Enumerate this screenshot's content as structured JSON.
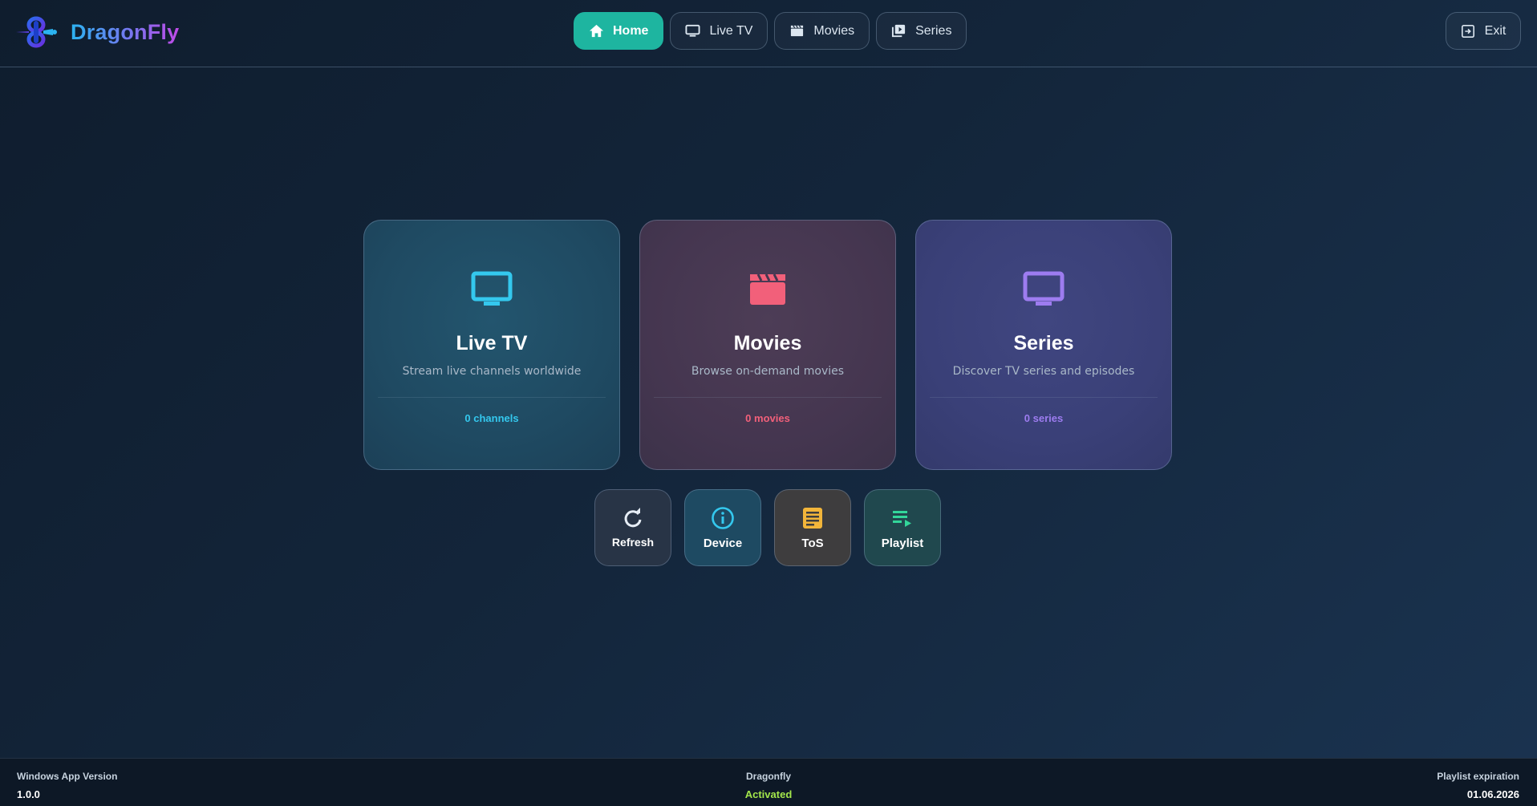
{
  "app": {
    "name": "DragonFly",
    "brand_gradient": [
      "#2bb3f0",
      "#6f7bf0",
      "#c04ae8"
    ]
  },
  "nav": {
    "items": [
      {
        "label": "Home",
        "icon": "home-icon",
        "active": true
      },
      {
        "label": "Live TV",
        "icon": "tv-icon",
        "active": false
      },
      {
        "label": "Movies",
        "icon": "clapperboard-icon",
        "active": false
      },
      {
        "label": "Series",
        "icon": "play-stack-icon",
        "active": false
      }
    ],
    "exit_label": "Exit",
    "active_color": "#1eb5a0"
  },
  "cards": [
    {
      "title": "Live TV",
      "subtitle": "Stream live channels worldwide",
      "count": "0 channels",
      "icon": "tv-icon",
      "accent": "#34c8ee"
    },
    {
      "title": "Movies",
      "subtitle": "Browse on-demand movies",
      "count": "0 movies",
      "icon": "clapperboard-icon",
      "accent": "#f2607a"
    },
    {
      "title": "Series",
      "subtitle": "Discover TV series and episodes",
      "count": "0 series",
      "icon": "tv-icon",
      "accent": "#9d7cf0"
    }
  ],
  "actions": [
    {
      "label": "Refresh",
      "icon": "refresh-icon"
    },
    {
      "label": "Device",
      "icon": "info-icon",
      "accent": "#34c8ee"
    },
    {
      "label": "ToS",
      "icon": "document-icon",
      "accent": "#f2b53a"
    },
    {
      "label": "Playlist",
      "icon": "playlist-icon",
      "accent": "#33d69a"
    }
  ],
  "footer": {
    "version_label": "Windows App Version",
    "version_value": "1.0.0",
    "center_label": "Dragonfly",
    "center_value": "Activated",
    "expiration_label": "Playlist expiration",
    "expiration_value": "01.06.2026",
    "activated_color": "#a3e64b"
  }
}
